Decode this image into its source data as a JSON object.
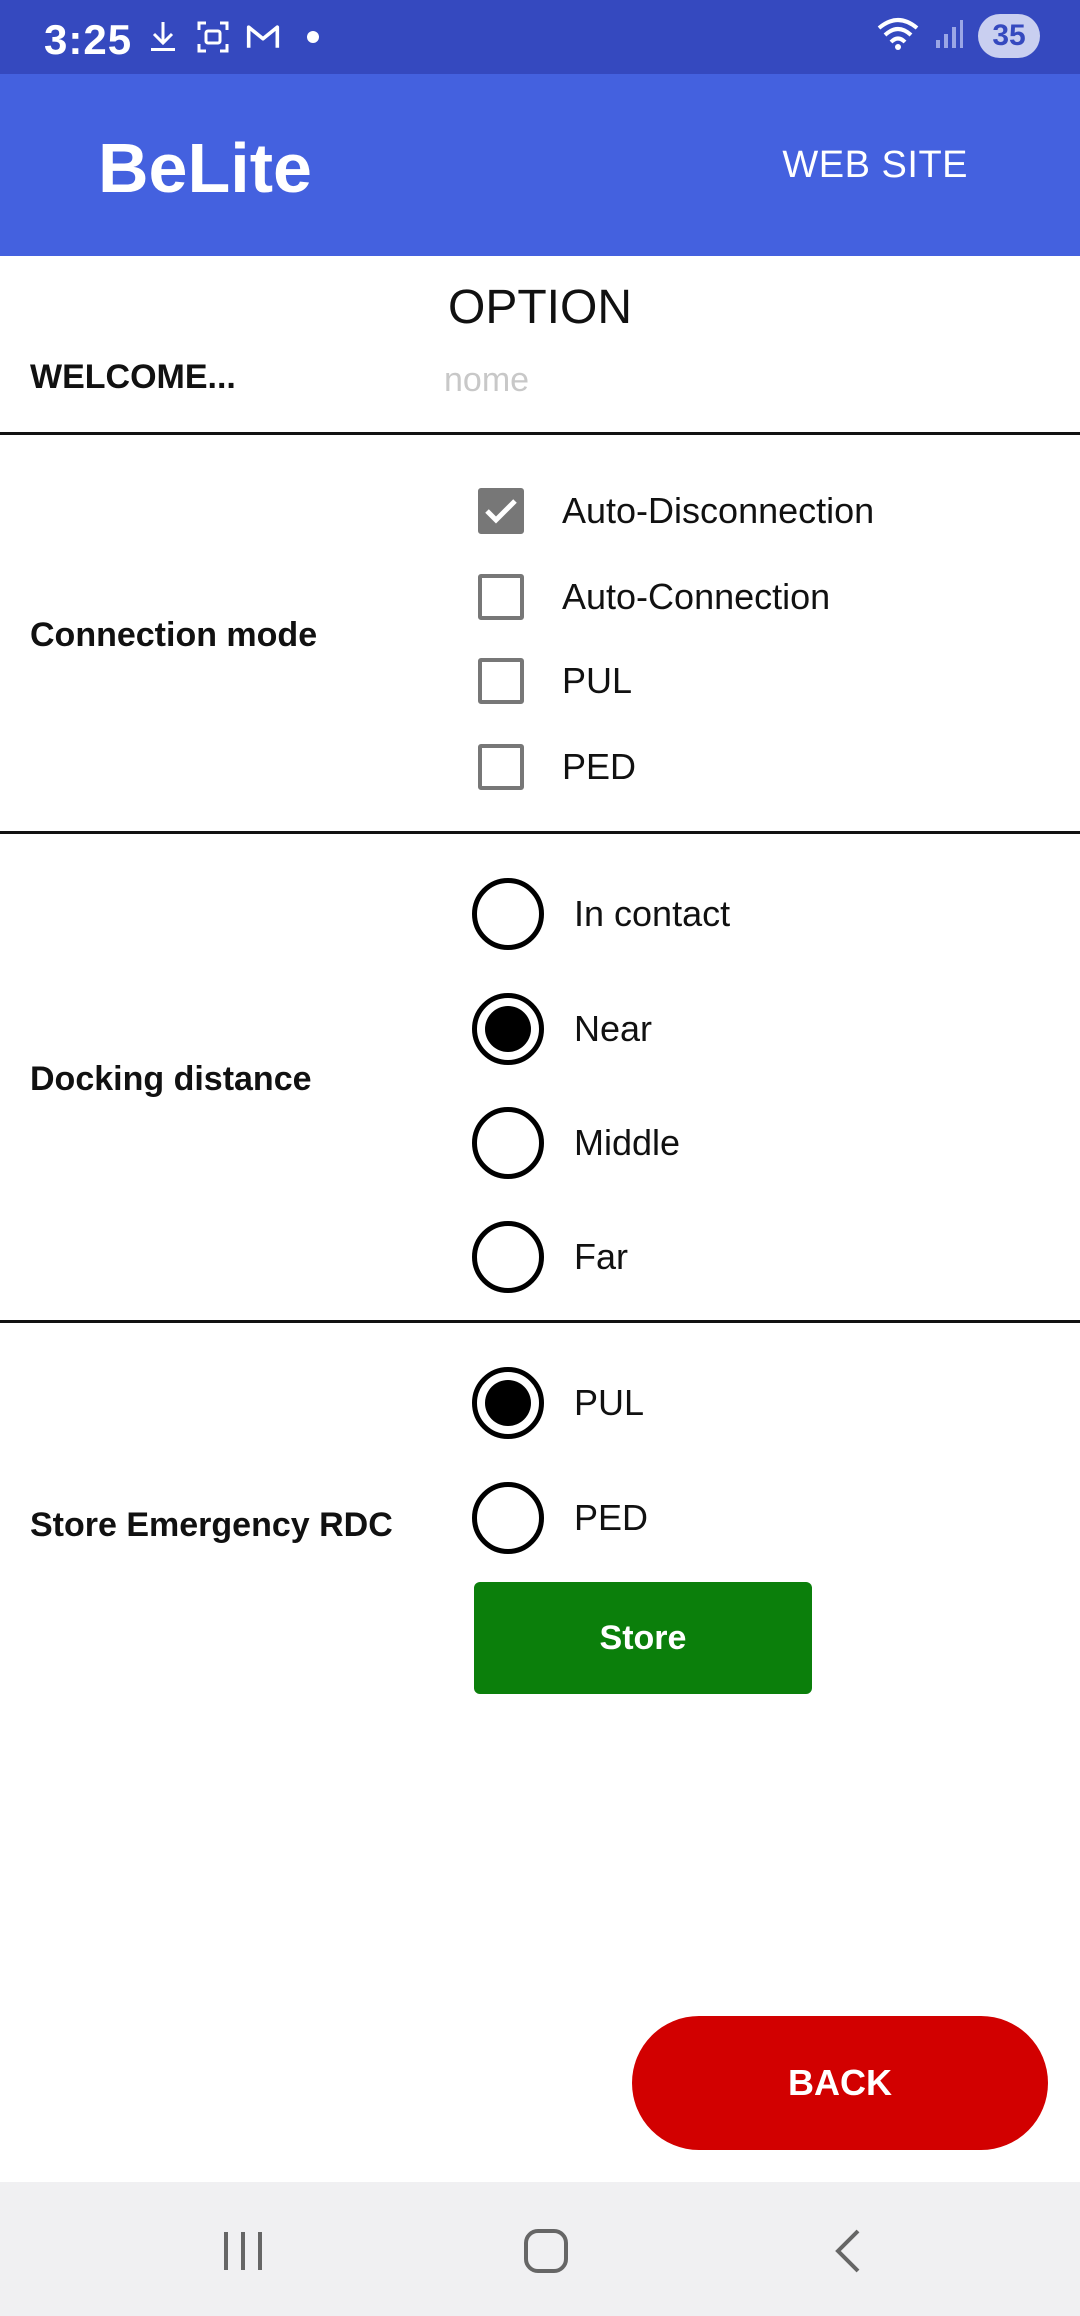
{
  "status_bar": {
    "time": "3:25",
    "battery": "35",
    "icons_left": [
      "download-icon",
      "screenshot-icon",
      "gmail-icon",
      "dot-icon"
    ],
    "icons_right": [
      "wifi-icon",
      "signal-icon",
      "battery-icon"
    ]
  },
  "app_bar": {
    "title": "BeLite",
    "website_label": "WEB SITE"
  },
  "header": {
    "title": "OPTION",
    "welcome_label": "WELCOME...",
    "name_placeholder": "nome",
    "name_value": ""
  },
  "connection_mode": {
    "label": "Connection mode",
    "options": [
      {
        "label": "Auto-Disconnection",
        "checked": true
      },
      {
        "label": "Auto-Connection",
        "checked": false
      },
      {
        "label": "PUL",
        "checked": false
      },
      {
        "label": "PED",
        "checked": false
      }
    ]
  },
  "docking_distance": {
    "label": "Docking distance",
    "options": [
      {
        "label": "In contact",
        "selected": false
      },
      {
        "label": "Near",
        "selected": true
      },
      {
        "label": "Middle",
        "selected": false
      },
      {
        "label": "Far",
        "selected": false
      }
    ]
  },
  "store_emergency": {
    "label": "Store Emergency RDC",
    "options": [
      {
        "label": "PUL",
        "selected": true
      },
      {
        "label": "PED",
        "selected": false
      }
    ],
    "store_label": "Store"
  },
  "back_label": "BACK",
  "colors": {
    "status_bar": "#3549BF",
    "app_bar": "#4461DF",
    "store_button": "#0B7F0B",
    "back_button": "#D20000"
  }
}
